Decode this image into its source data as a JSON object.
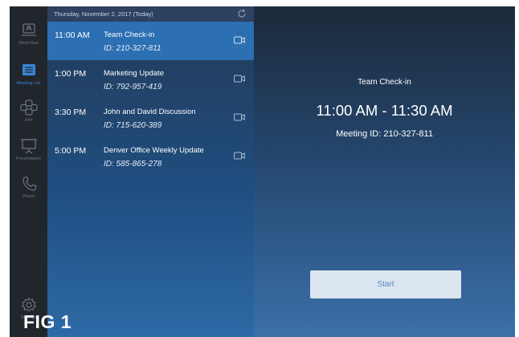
{
  "rail": {
    "items": [
      {
        "label": "Meet Now",
        "icon": "meet-now-icon",
        "active": false
      },
      {
        "label": "Meeting List",
        "icon": "meeting-list-icon",
        "active": true
      },
      {
        "label": "Join",
        "icon": "join-icon",
        "active": false
      },
      {
        "label": "Presentation",
        "icon": "presentation-icon",
        "active": false
      },
      {
        "label": "Phone",
        "icon": "phone-icon",
        "active": false
      }
    ],
    "settings_label": "Settings",
    "active_color": "#3b84d6",
    "inactive_color": "#6c7480"
  },
  "list": {
    "date_header": "Thursday, November 2, 2017 (Today)",
    "meetings": [
      {
        "time": "11:00 AM",
        "title": "Team Check-in",
        "id": "ID: 210-327-811",
        "selected": true
      },
      {
        "time": "1:00 PM",
        "title": "Marketing Update",
        "id": "ID: 792-957-419",
        "selected": false
      },
      {
        "time": "3:30 PM",
        "title": "John and David Discussion",
        "id": "ID: 715-620-389",
        "selected": false
      },
      {
        "time": "5:00 PM",
        "title": "Denver Office Weekly Update",
        "id": "ID: 585-865-278",
        "selected": false
      }
    ],
    "selected_color": "#2c6fb2"
  },
  "detail": {
    "title": "Team Check-in",
    "time_range": "11:00 AM - 11:30 AM",
    "meeting_id": "Meeting ID: 210-327-811",
    "start_label": "Start"
  },
  "figure_label": "FIG 1"
}
